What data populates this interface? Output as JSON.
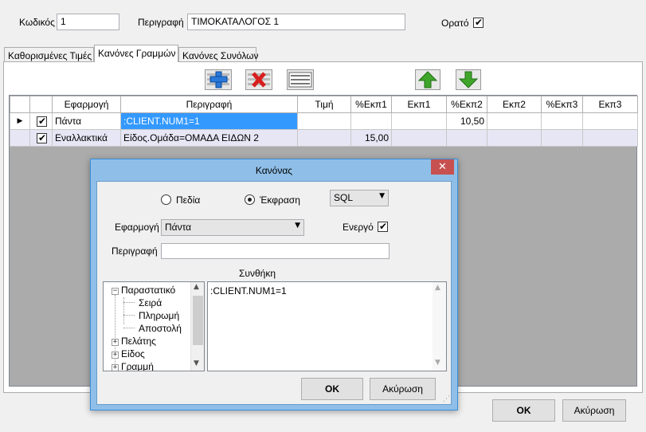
{
  "header": {
    "code_label": "Κωδικός",
    "code_value": "1",
    "description_label": "Περιγραφή",
    "description_value": "ΤΙΜΟΚΑΤΑΛΟΓΟΣ 1",
    "visible_label": "Ορατό",
    "visible_checked": true
  },
  "tabs": [
    {
      "label": "Καθορισμένες Τιμές",
      "active": false
    },
    {
      "label": "Κανόνες Γραμμών",
      "active": true
    },
    {
      "label": "Κανόνες Συνόλων",
      "active": false
    }
  ],
  "toolbar": {
    "icons": [
      "add-icon",
      "delete-icon",
      "list-icon",
      "move-up-icon",
      "move-down-icon"
    ],
    "colors": {
      "add": "#2a78d8",
      "delete": "#d81e1e",
      "arrows": "#3fa52a"
    }
  },
  "grid": {
    "columns": [
      "Εφαρμογή",
      "Περιγραφή",
      "Τιμή",
      "%Εκπ1",
      "Εκπ1",
      "%Εκπ2",
      "Εκπ2",
      "%Εκπ3",
      "Εκπ3"
    ],
    "rows": [
      {
        "current": true,
        "checked": true,
        "apply": "Πάντα",
        "description": ":CLIENT.NUM1=1",
        "price": "",
        "disc1_pct": "",
        "disc1": "",
        "disc2_pct": "10,50",
        "disc2": "",
        "disc3_pct": "",
        "disc3": ""
      },
      {
        "current": false,
        "checked": true,
        "apply": "Εναλλακτικά",
        "description": "Είδος.Ομάδα=ΟΜΑΔΑ ΕΙΔΩΝ 2",
        "price": "",
        "disc1_pct": "15,00",
        "disc1": "",
        "disc2_pct": "",
        "disc2": "",
        "disc3_pct": "",
        "disc3": ""
      }
    ],
    "current_marker": "▶"
  },
  "dialog": {
    "title": "Κανόνας",
    "close_icon": "close-icon",
    "mode_fields_label": "Πεδία",
    "mode_expression_label": "Έκφραση",
    "mode_selected": "expression",
    "language_value": "SQL",
    "apply_label": "Εφαρμογή",
    "apply_value": "Πάντα",
    "active_label": "Ενεργό",
    "active_checked": true,
    "description_label": "Περιγραφή",
    "description_value": "",
    "condition_label": "Συνθήκη",
    "tree": [
      {
        "label": "Παραστατικό",
        "expanded": true,
        "level": 0
      },
      {
        "label": "Σειρά",
        "level": 1
      },
      {
        "label": "Πληρωμή",
        "level": 1
      },
      {
        "label": "Αποστολή",
        "level": 1
      },
      {
        "label": "Πελάτης",
        "expanded": false,
        "level": 0
      },
      {
        "label": "Είδος",
        "expanded": false,
        "level": 0
      },
      {
        "label": "Γραμμή",
        "expanded": false,
        "level": 0
      }
    ],
    "condition_text": ":CLIENT.NUM1=1",
    "ok_label": "OK",
    "cancel_label": "Ακύρωση"
  },
  "footer": {
    "ok_label": "OK",
    "cancel_label": "Ακύρωση"
  },
  "colors": {
    "selection": "#3399ff",
    "alt_row": "#e6e6f5",
    "grid_area": "#ababab",
    "dialog_frame": "#8fbfe8"
  }
}
